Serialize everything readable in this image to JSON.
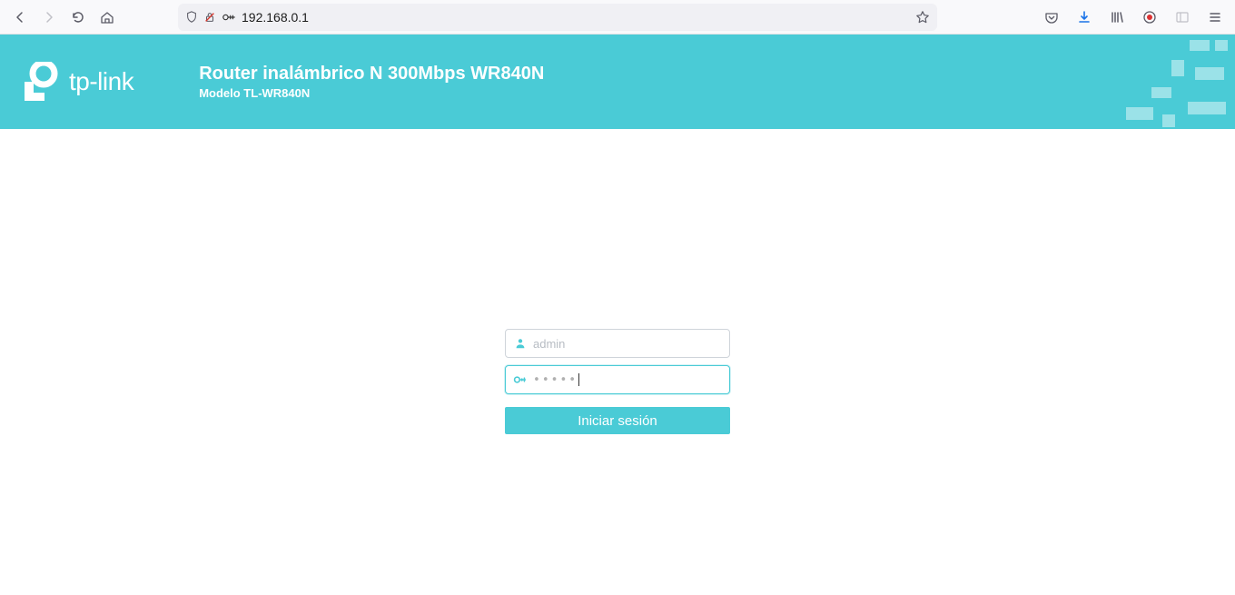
{
  "browser": {
    "url": "192.168.0.1"
  },
  "header": {
    "brand": "tp-link",
    "title": "Router inalámbrico N 300Mbps WR840N",
    "model": "Modelo TL-WR840N"
  },
  "login": {
    "username_placeholder": "admin",
    "username_value": "",
    "password_value": "•••••",
    "button_label": "Iniciar sesión"
  },
  "colors": {
    "accent": "#4acbd6"
  }
}
